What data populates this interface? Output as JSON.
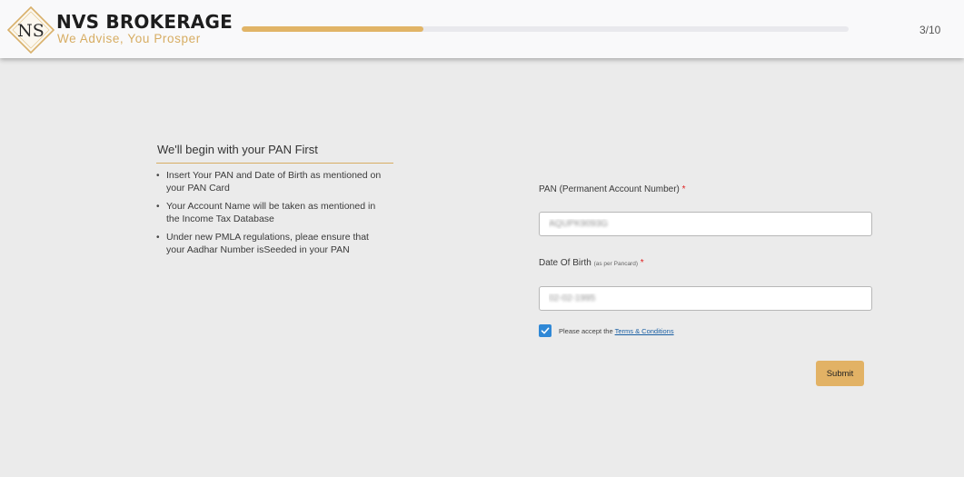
{
  "header": {
    "logo_initials": "NS",
    "brand_name": "NVS BROKERAGE",
    "tagline": "We Advise, You Prosper",
    "step_text": "3/10",
    "progress_fraction": 0.3
  },
  "intro": {
    "title": "We'll begin with your PAN First",
    "bullets": [
      "Insert Your PAN and Date of Birth as mentioned on your PAN Card",
      "Your Account Name will be taken as mentioned in the Income Tax Database",
      "Under new PMLA regulations, pleae ensure that your Aadhar Number isSeeded in your PAN"
    ]
  },
  "form": {
    "pan": {
      "label": "PAN (Permanent Account Number)",
      "required_mark": "*",
      "value": "AQUPK9093G"
    },
    "dob": {
      "label": "Date Of Birth",
      "label_hint": "(as per Pancard)",
      "required_mark": "*",
      "value": "02-02-1995"
    },
    "consent": {
      "checked": true,
      "text": "Please accept the",
      "link_text": "Terms & Conditions"
    },
    "submit_label": "Submit"
  },
  "colors": {
    "accent_gold": "#e2b265",
    "checkbox_blue": "#2f88d6",
    "link_blue": "#1a5fa3",
    "required_red": "#e02020"
  }
}
